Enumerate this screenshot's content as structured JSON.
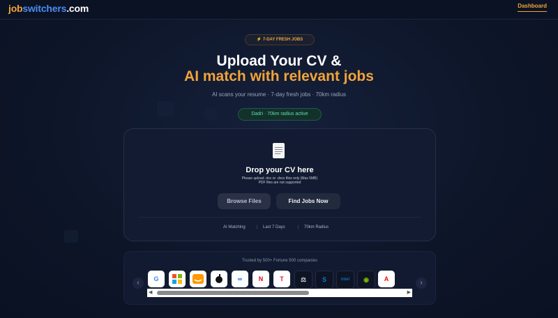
{
  "header": {
    "logo_part1": "job",
    "logo_part2": "switchers",
    "logo_part3": ".com",
    "dashboard_label": "Dashboard"
  },
  "hero": {
    "badge": "⚡ 7-DAY FRESH JOBS",
    "title_line1": "Upload Your CV &",
    "title_line2": "AI match with relevant jobs",
    "subtitle": "AI scans your resume · 7-day fresh jobs · 70km radius",
    "location_chip": "Dadri · 70km radius active"
  },
  "upload": {
    "title": "Drop your CV here",
    "note1": "Please upload .doc or .docx files only (Max 5MB)",
    "note2": "PDF files are not supported",
    "browse_label": "Browse Files",
    "find_label": "Find Jobs Now",
    "features": [
      "AI Matching",
      "Last 7 Days",
      "70km Radius"
    ]
  },
  "trusted": {
    "label": "Trusted by 500+ Fortune 500 companies",
    "prev": "‹",
    "next": "›",
    "companies": [
      {
        "icon": "google-icon",
        "glyph": "G",
        "color": "#4285f4"
      },
      {
        "icon": "microsoft-icon",
        "glyph": "",
        "color": "#f25022"
      },
      {
        "icon": "amazon-icon",
        "glyph": "⌣",
        "color": "#ff9900"
      },
      {
        "icon": "apple-icon",
        "glyph": "",
        "color": "#111111"
      },
      {
        "icon": "meta-icon",
        "glyph": "∞",
        "color": "#0866ff"
      },
      {
        "icon": "netflix-icon",
        "glyph": "N",
        "color": "#e50914"
      },
      {
        "icon": "tesla-icon",
        "glyph": "T",
        "color": "#e31937"
      },
      {
        "icon": "ibm-icon",
        "glyph": "⚖",
        "color": "#c8cdd8"
      },
      {
        "icon": "salesforce-icon",
        "glyph": "S",
        "color": "#0a7cd6"
      },
      {
        "icon": "intel-icon",
        "glyph": "intel",
        "color": "#0071c5"
      },
      {
        "icon": "nvidia-icon",
        "glyph": "◉",
        "color": "#76b900"
      },
      {
        "icon": "adobe-icon",
        "glyph": "A",
        "color": "#fa0f00"
      }
    ]
  },
  "scrollbar": {
    "left_arrow": "◀",
    "right_arrow": "▶"
  }
}
